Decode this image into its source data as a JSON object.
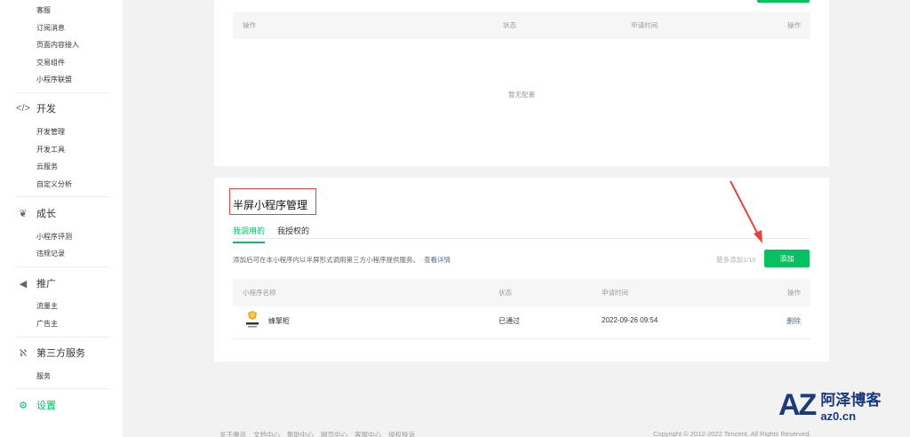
{
  "sidebar": {
    "top_items": [
      "客服",
      "订阅消息",
      "页面内容接入",
      "交易组件",
      "小程序联盟"
    ],
    "groups": [
      {
        "label": "开发",
        "icon": "code-icon",
        "items": [
          "开发管理",
          "开发工具",
          "云服务",
          "自定义分析"
        ]
      },
      {
        "label": "成长",
        "icon": "growth-icon",
        "items": [
          "小程序评测",
          "违规记录"
        ]
      },
      {
        "label": "推广",
        "icon": "megaphone-icon",
        "items": [
          "流量主",
          "广告主"
        ]
      },
      {
        "label": "第三方服务",
        "icon": "third-party-icon",
        "items": [
          "服务"
        ]
      },
      {
        "label": "设置",
        "icon": "gear-icon",
        "items": []
      }
    ]
  },
  "top_table": {
    "headers": [
      "操作",
      "状态",
      "申请时间",
      "操作"
    ],
    "empty_text": "暂无配置"
  },
  "half_screen": {
    "title": "半屏小程序管理",
    "tabs": [
      "我调用的",
      "我授权的"
    ],
    "description": "添加后可在本小程序内以半屏形式调用第三方小程序提供服务。",
    "detail_link": "查看详情",
    "limit_text": "最多添加1/10",
    "add_button": "添加",
    "headers": [
      "小程序名称",
      "状态",
      "申请时间",
      "操作"
    ],
    "rows": [
      {
        "name": "蜂擎柜",
        "status": "已通过",
        "time": "2022-09-26 09:54",
        "action": "删除"
      }
    ]
  },
  "footer": {
    "links": [
      "关于腾讯",
      "文档中心",
      "帮助中心",
      "网页中心",
      "客服中心",
      "侵权投诉"
    ],
    "copyright": "Copyright © 2012-2022 Tencent. All Rights Reserved."
  },
  "watermark": {
    "logo": "AZ",
    "name": "阿泽博客",
    "url": "az0.cn"
  },
  "colors": {
    "accent": "#07c160",
    "link": "#576b95",
    "highlight": "#e64340"
  }
}
